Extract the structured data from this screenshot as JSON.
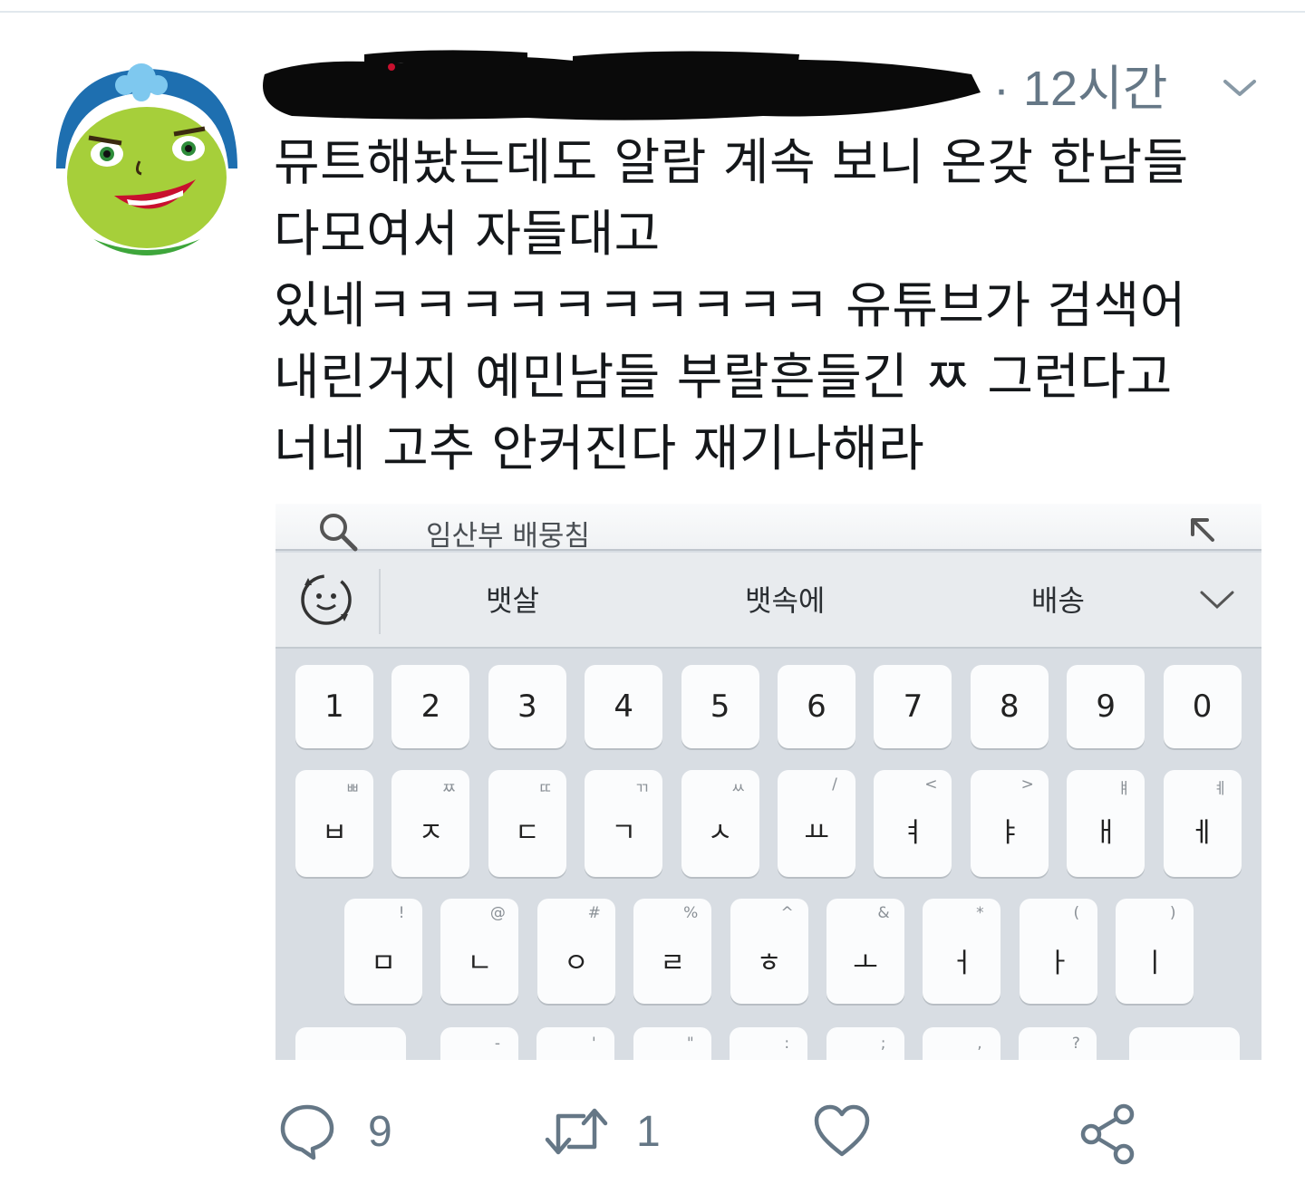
{
  "tweet": {
    "timestamp": "· 12시간",
    "text_lines": [
      "뮤트해놨는데도 알람 계속 보니 온갖 한남들",
      "다모여서 자들대고",
      "있네ㅋㅋㅋㅋㅋㅋㅋㅋㅋㅋ 유튜브가 검색어",
      "내린거지 예민남들 부랄흔들긴 ㅉ 그런다고",
      "너네 고추 안커진다 재기나해라"
    ]
  },
  "media": {
    "search_text": "임산부 배뭉침",
    "suggestions": [
      "뱃살",
      "뱃속에",
      "배송"
    ],
    "number_row": [
      {
        "main": "1",
        "sub": ""
      },
      {
        "main": "2",
        "sub": ""
      },
      {
        "main": "3",
        "sub": ""
      },
      {
        "main": "4",
        "sub": ""
      },
      {
        "main": "5",
        "sub": ""
      },
      {
        "main": "6",
        "sub": ""
      },
      {
        "main": "7",
        "sub": ""
      },
      {
        "main": "8",
        "sub": ""
      },
      {
        "main": "9",
        "sub": ""
      },
      {
        "main": "0",
        "sub": ""
      }
    ],
    "row2": [
      {
        "main": "ㅂ",
        "sub": "ㅃ"
      },
      {
        "main": "ㅈ",
        "sub": "ㅉ"
      },
      {
        "main": "ㄷ",
        "sub": "ㄸ"
      },
      {
        "main": "ㄱ",
        "sub": "ㄲ"
      },
      {
        "main": "ㅅ",
        "sub": "ㅆ"
      },
      {
        "main": "ㅛ",
        "sub": "/"
      },
      {
        "main": "ㅕ",
        "sub": "<"
      },
      {
        "main": "ㅑ",
        "sub": ">"
      },
      {
        "main": "ㅐ",
        "sub": "ㅒ"
      },
      {
        "main": "ㅔ",
        "sub": "ㅖ"
      }
    ],
    "row3": [
      {
        "main": "ㅁ",
        "sub": "!"
      },
      {
        "main": "ㄴ",
        "sub": "@"
      },
      {
        "main": "ㅇ",
        "sub": "#"
      },
      {
        "main": "ㄹ",
        "sub": "%"
      },
      {
        "main": "ㅎ",
        "sub": "^"
      },
      {
        "main": "ㅗ",
        "sub": "&"
      },
      {
        "main": "ㅓ",
        "sub": "*"
      },
      {
        "main": "ㅏ",
        "sub": "("
      },
      {
        "main": "ㅣ",
        "sub": ")"
      }
    ],
    "row4_subs": [
      "-",
      "'",
      "\"",
      ":",
      ";",
      ",",
      "?"
    ]
  },
  "actions": {
    "reply_count": "9",
    "retweet_count": "1"
  },
  "colors": {
    "text": "#14171a",
    "muted": "#657786",
    "divider": "#e1e8ed",
    "keyboard_bg": "#d8dde3"
  }
}
